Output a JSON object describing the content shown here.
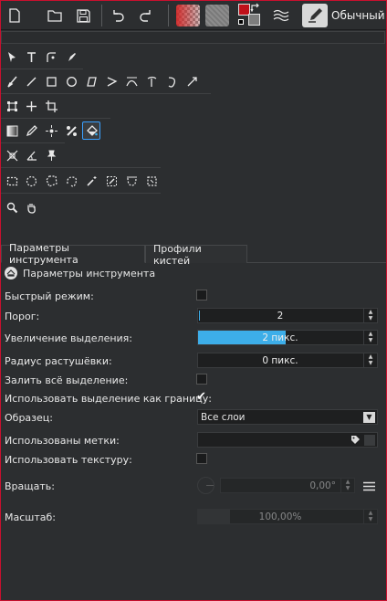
{
  "toolbar": {
    "mode_label": "Обычный",
    "icons": [
      "new-document-icon",
      "open-folder-icon",
      "save-icon",
      "undo-icon",
      "redo-icon"
    ]
  },
  "colors": {
    "foreground": "#c0101a",
    "background": "#7d7d7d",
    "accent": "#3daee9"
  },
  "tabs": [
    "Параметры инструмента",
    "Профили кистей"
  ],
  "panel": {
    "title": "Параметры инструмента",
    "fast_mode_label": "Быстрый режим:",
    "threshold_label": "Порог:",
    "threshold_value": "2",
    "grow_label": "Увеличение выделения:",
    "grow_value": "2 пикс.",
    "grow_fill_fraction": 0.49,
    "feather_label": "Радиус растушёвки:",
    "feather_value": "0 пикс.",
    "fill_all_label": "Залить всё выделение:",
    "use_boundary_label": "Использовать выделение как границу:",
    "sample_label": "Образец:",
    "sample_value": "Все слои",
    "tags_label": "Использованы метки:",
    "texture_label": "Использовать текстуру:",
    "rotate_label": "Вращать:",
    "rotate_value": "0,00°",
    "scale_label": "Масштаб:",
    "scale_value": "100,00%"
  }
}
